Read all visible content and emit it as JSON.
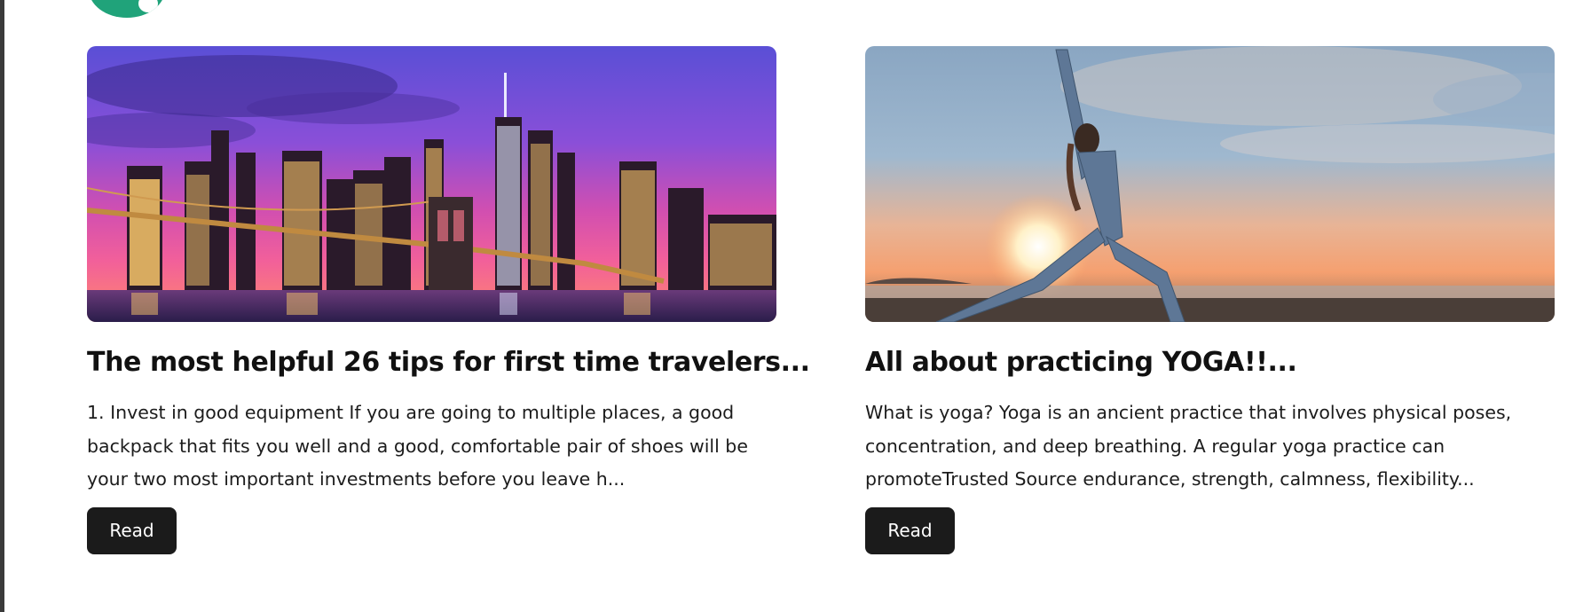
{
  "posts": [
    {
      "title": "The most helpful 26 tips for first time travelers...",
      "excerpt": "1. Invest in good equipment If you are going to multiple places, a good backpack that fits you well and a good, comfortable pair of shoes will be your two most important investments before you leave h...",
      "image_subject": "city skyline at dusk with bridge",
      "button_label": "Read"
    },
    {
      "title": "All about practicing YOGA!!...",
      "excerpt": "What is yoga? Yoga is an ancient practice that involves physical poses, concentration, and deep breathing. A regular yoga practice can promoteTrusted Source endurance, strength, calmness, flexibility...",
      "image_subject": "woman doing yoga pose on beach at sunset",
      "button_label": "Read"
    }
  ],
  "colors": {
    "brand_logo": "#20a37a",
    "button_bg": "#1b1b1b",
    "button_text": "#ffffff",
    "title_text": "#111111"
  }
}
